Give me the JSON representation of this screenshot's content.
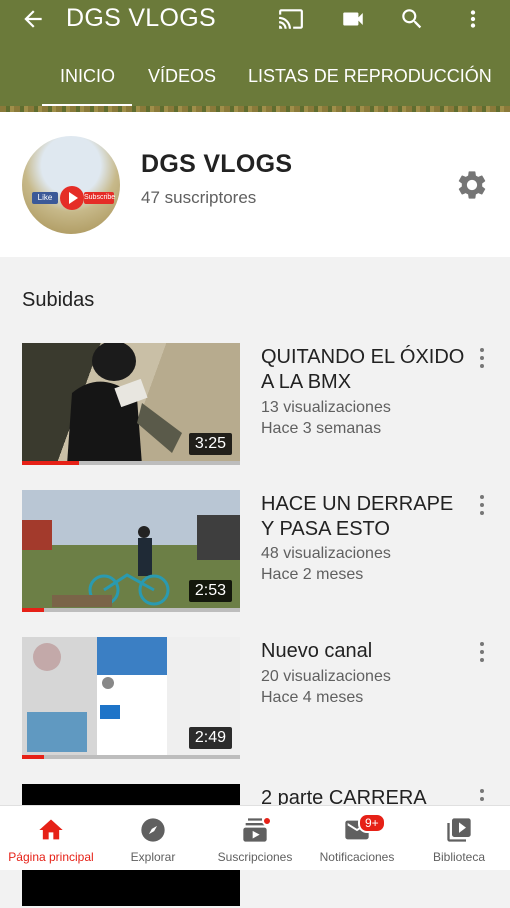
{
  "header": {
    "title": "DGS VLOGS",
    "tabs": [
      {
        "label": "INICIO",
        "active": true
      },
      {
        "label": "VÍDEOS",
        "active": false
      },
      {
        "label": "LISTAS DE REPRODUCCIÓN",
        "active": false
      }
    ],
    "icons": [
      "back-arrow-icon",
      "cast-icon",
      "video-camera-icon",
      "search-icon",
      "more-vert-icon"
    ]
  },
  "channel": {
    "name": "DGS VLOGS",
    "subscribers": "47 suscriptores",
    "avatar_text": {
      "like": "Like",
      "subscribe": "Subscribe"
    }
  },
  "section": {
    "title": "Subidas"
  },
  "videos": [
    {
      "title": "QUITANDO EL ÓXIDO A LA BMX",
      "views": "13 visualizaciones",
      "age": "Hace 3 semanas",
      "duration": "3:25",
      "watched": 0.26
    },
    {
      "title": "HACE UN DERRAPE Y PASA ESTO",
      "views": "48 visualizaciones",
      "age": "Hace 2 meses",
      "duration": "2:53",
      "watched": 0.1
    },
    {
      "title": "Nuevo canal",
      "views": "20 visualizaciones",
      "age": "Hace 4 meses",
      "duration": "2:49",
      "watched": 0.1
    },
    {
      "title": "2 parte CARRERA",
      "views": "",
      "age": "",
      "duration": "",
      "watched": 0
    }
  ],
  "nav": {
    "items": [
      {
        "label": "Página principal",
        "icon": "home-icon",
        "active": true
      },
      {
        "label": "Explorar",
        "icon": "compass-icon",
        "active": false
      },
      {
        "label": "Suscripciones",
        "icon": "subscriptions-icon",
        "active": false
      },
      {
        "label": "Notificaciones",
        "icon": "notifications-icon",
        "active": false,
        "badge": "9+"
      },
      {
        "label": "Biblioteca",
        "icon": "library-icon",
        "active": false
      }
    ]
  },
  "colors": {
    "appbar": "#6b7a3a",
    "accent": "#e62117"
  }
}
